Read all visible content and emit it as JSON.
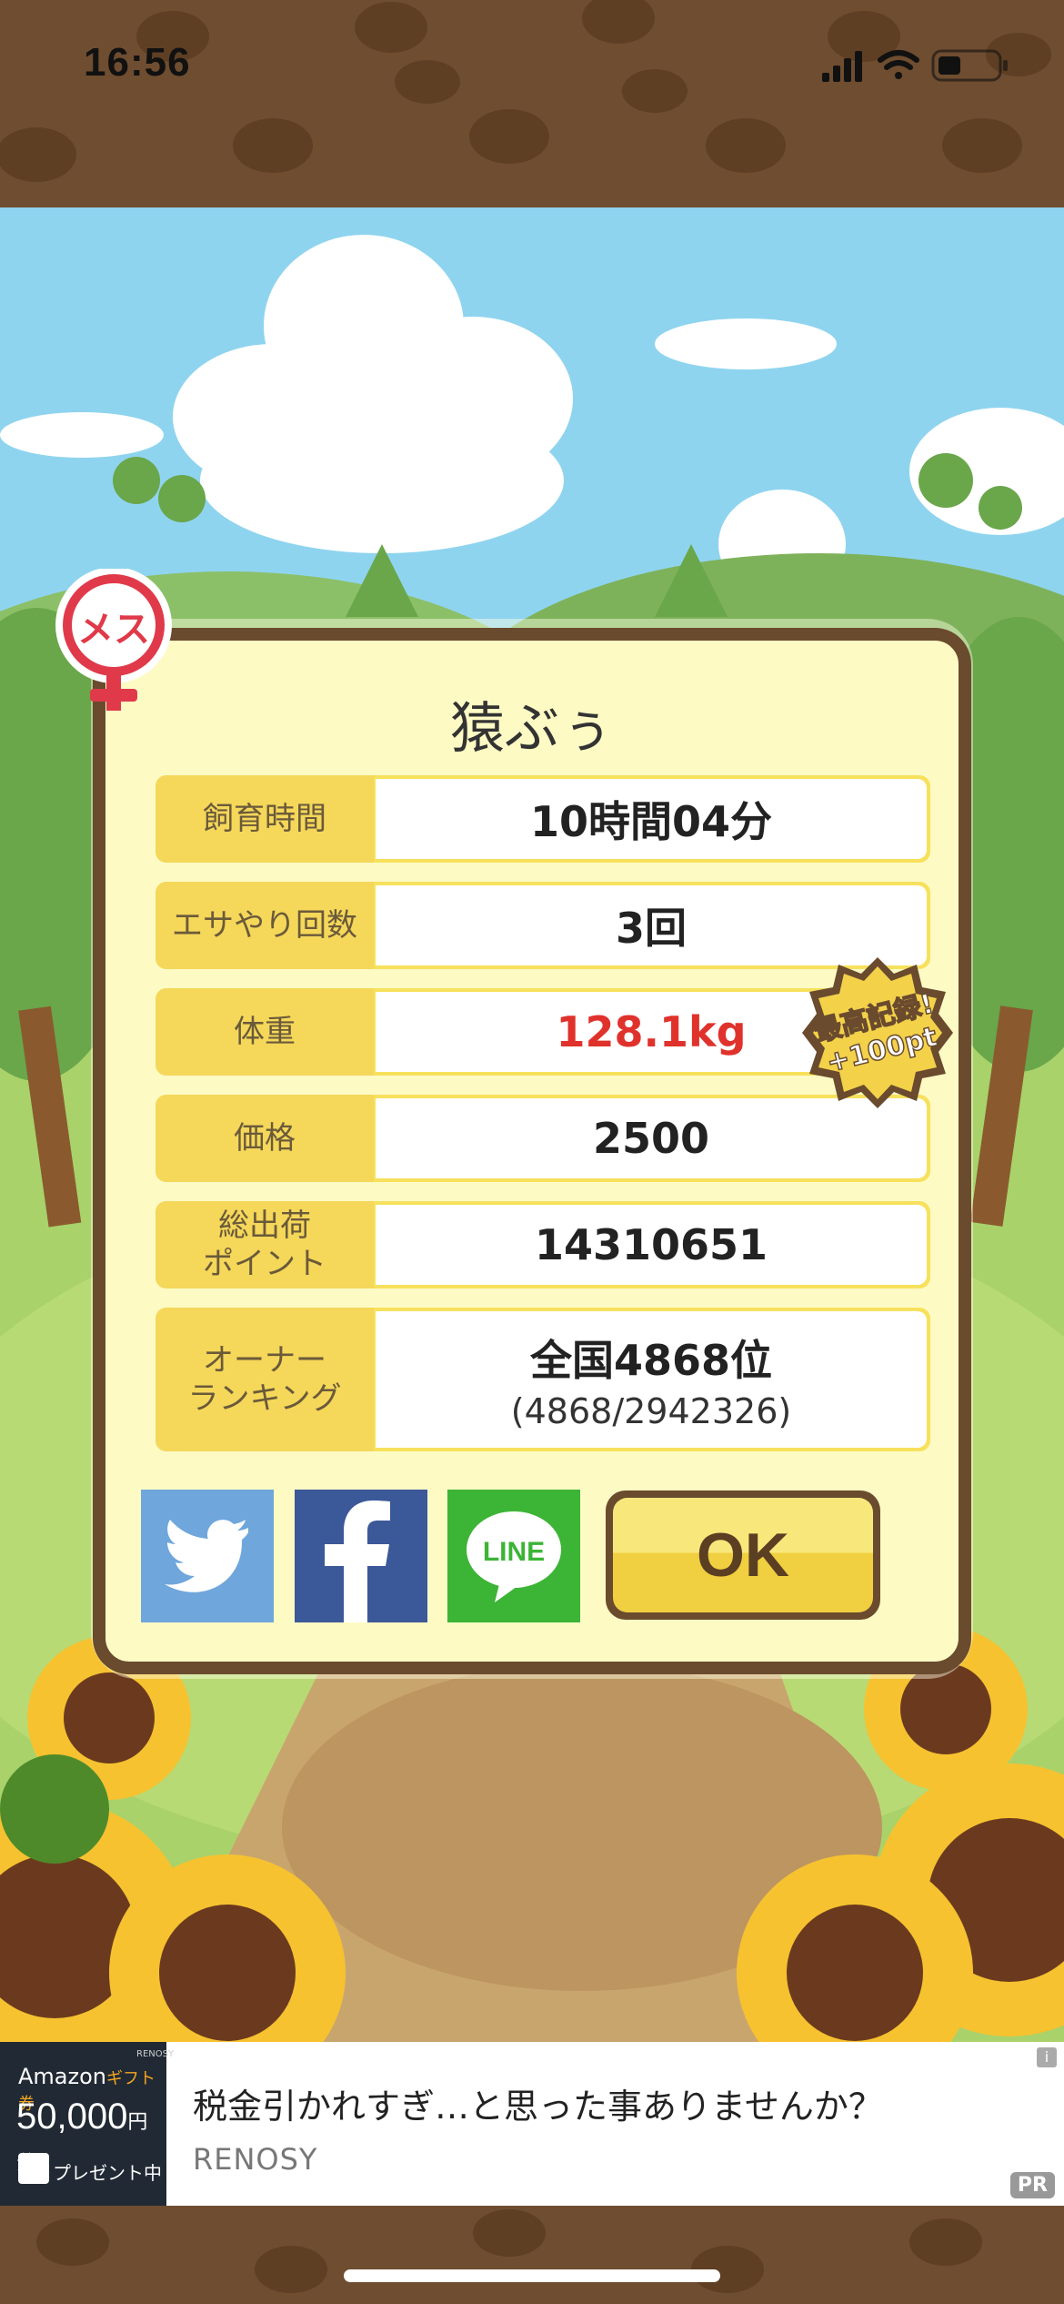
{
  "status_bar": {
    "time": "16:56"
  },
  "pet": {
    "name": "猿ぶぅ",
    "gender_label": "メス"
  },
  "stats": [
    {
      "label": "飼育時間",
      "value": "10時間04分"
    },
    {
      "label": "エサやり回数",
      "value": "3回"
    },
    {
      "label": "体重",
      "value": "128.1kg",
      "highlight": true
    },
    {
      "label": "価格",
      "value": "2500"
    },
    {
      "label": "総出荷\nポイント",
      "value": "14310651"
    },
    {
      "label": "オーナー\nランキング",
      "value": "全国4868位",
      "sub": "(4868/2942326)"
    }
  ],
  "record_badge": {
    "line1": "最高記録!",
    "line2": "+100pt"
  },
  "share": {
    "line_label": "LINE"
  },
  "ok_label": "OK",
  "ad": {
    "brand": "RENOSY",
    "amazon": "Amazon",
    "gift": "ギフト券",
    "amount": "50,000",
    "amount_unit": "円分",
    "present": "プレゼント中",
    "title": "税金引かれすぎ…と思った事ありませんか？",
    "sponsor": "RENOSY",
    "pr": "PR",
    "info": "i"
  },
  "colors": {
    "accent": "#f5d75a",
    "frame": "#6a4b2e",
    "highlight": "#e0322c",
    "twitter": "#6fa6dc",
    "facebook": "#3b5898",
    "line": "#3cb436"
  }
}
